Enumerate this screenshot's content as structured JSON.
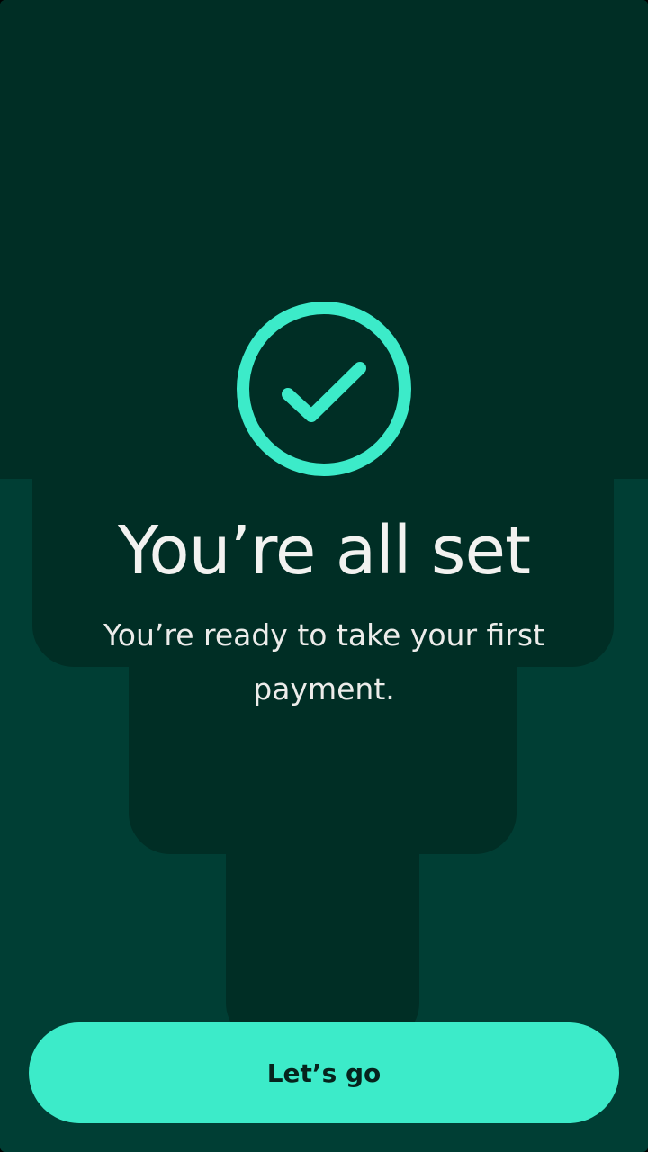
{
  "colors": {
    "background": "#003e34",
    "shape": "#002e25",
    "accent": "#3cebc9",
    "text": "#f2f2f0",
    "button_text": "#06231d"
  },
  "hero": {
    "icon": "check-circle-icon",
    "title": "You’re all set",
    "subtitle": "You’re ready to take your first payment."
  },
  "actions": {
    "primary_label": "Let’s go"
  }
}
